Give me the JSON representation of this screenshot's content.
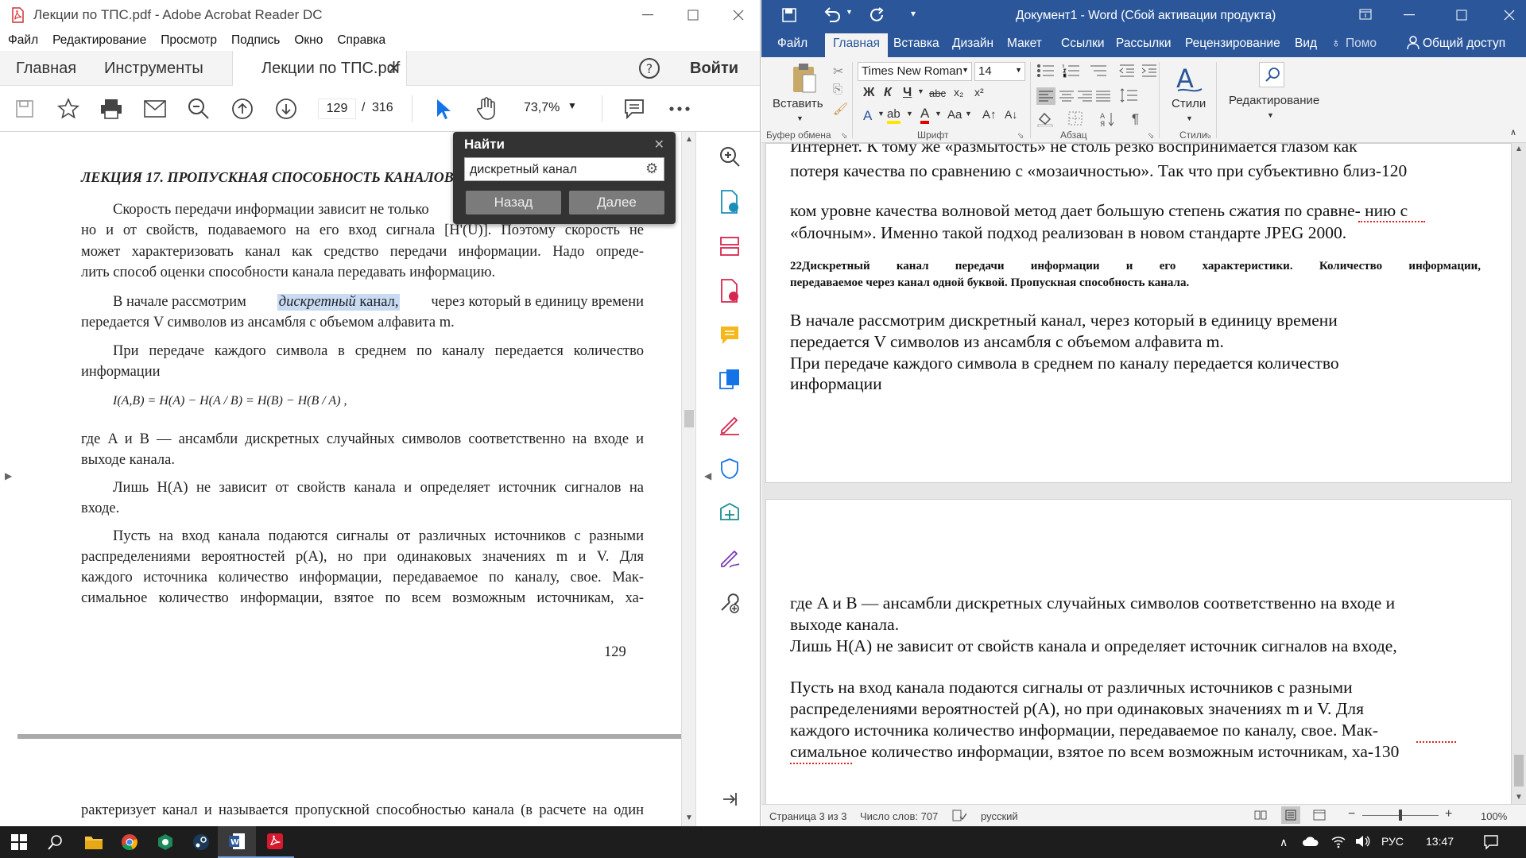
{
  "acrobat": {
    "window_title": "Лекции по ТПС.pdf - Adobe Acrobat Reader DC",
    "menu": [
      "Файл",
      "Редактирование",
      "Просмотр",
      "Подпись",
      "Окно",
      "Справка"
    ],
    "tabs": {
      "home": "Главная",
      "tools": "Инструменты",
      "doc": "Лекции по ТПС.pdf"
    },
    "signin": "Войти",
    "page_current": "129",
    "page_sep": "/",
    "page_total": "316",
    "zoom": "73,7%",
    "find": {
      "title": "Найти",
      "query": "дискретный канал",
      "prev": "Назад",
      "next": "Далее"
    },
    "doc_lines": [
      "ЛЕКЦИЯ 17. ПРОПУСКНАЯ СПОСОБНОСТЬ КАНАЛОВ",
      "Скорость передачи информации зависит не только",
      "но и от свойств, подаваемого на его вход сигнала [H'(U)]. Поэтому скорость не",
      "может характеризовать канал как средство передачи информации. Надо опреде-",
      "лить способ оценки способности канала передавать информацию.",
      "В начале рассмотрим",
      "дискретный",
      "канал,",
      "через который в единицу времени",
      "передается V символов из ансамбля с объемом алфавита m.",
      "При передаче каждого символа в среднем по каналу передается количество",
      "информации",
      "I(A,B) = H(A) − H(A / B) = H(B) − H(B / A) ,",
      "где A и B — ансамбли дискретных случайных символов соответственно на входе и",
      "выходе канала.",
      "Лишь H(A) не зависит от свойств канала и определяет источник сигналов на",
      "входе.",
      "Пусть на вход канала подаются сигналы от различных источников с разными",
      "распределениями вероятностей p(A), но при одинаковых значениях m и V. Для",
      "каждого источника количество информации, передаваемое по каналу, свое. Мак-",
      "симальное количество информации, взятое по всем возможным источникам, ха-",
      "129",
      "рактеризует канал и называется пропускной способностью канала (в расчете на один"
    ]
  },
  "word": {
    "window_title": "Документ1 - Word (Сбой активации продукта)",
    "tabs": [
      "Файл",
      "Главная",
      "Вставка",
      "Дизайн",
      "Макет",
      "Ссылки",
      "Рассылки",
      "Рецензирование",
      "Вид"
    ],
    "help": "Помо",
    "share": "Общий доступ",
    "ribbon": {
      "paste": "Вставить",
      "clipboard": "Буфер обмена",
      "font_name": "Times New Roman",
      "font_size": "14",
      "font_group": "Шрифт",
      "paragraph_group": "Абзац",
      "styles": "Стили",
      "styles_group": "Стили",
      "editing": "Редактирование",
      "bold": "Ж",
      "italic": "К",
      "underline": "Ч",
      "strike": "abc"
    },
    "page1_lines": [
      "Интернет. К тому же «размытость» не столь резко воспринимается глазом как",
      "потеря качества по сравнению с «мозаичностью». Так что при субъективно близ-120",
      "ком уровне качества волновой метод дает большую степень сжатия по сравне- нию с",
      "«блочным». Именно такой подход реализован в новом стандарте JPEG 2000.",
      "22Дискретный канал передачи информации и его характеристики. Количество информации,",
      "передаваемое через канал одной буквой. Пропускная способность канала.",
      "В начале рассмотрим дискретный канал, через который в единицу времени",
      "передается V символов из ансамбля с объемом алфавита m.",
      "При передаче каждого символа в среднем по каналу передается количество",
      "информации"
    ],
    "page2_lines": [
      "где A и B — ансамбли дискретных случайных символов соответственно на входе и",
      "выходе канала.",
      "Лишь H(A) не зависит от свойств канала и определяет источник сигналов на входе,",
      "Пусть на вход канала подаются сигналы от различных источников с разными",
      "распределениями вероятностей p(A), но при одинаковых значениях m и V. Для",
      "каждого источника количество информации, передаваемое по каналу, свое. Мак-",
      "симальное количество информации, взятое по всем возможным источникам, ха-130"
    ],
    "status": {
      "page": "Страница 3 из 3",
      "words": "Число слов: 707",
      "lang": "русский",
      "zoom": "100%"
    }
  },
  "taskbar": {
    "lang": "РУС",
    "time": "13:47"
  }
}
